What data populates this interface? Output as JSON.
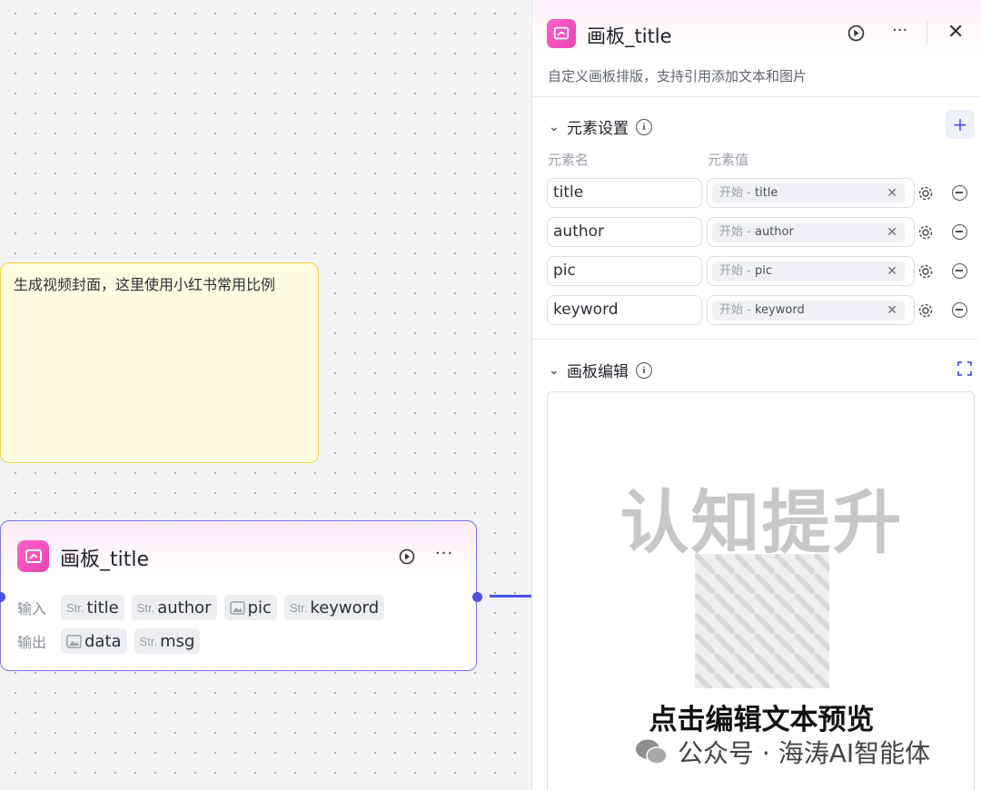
{
  "canvas": {
    "note": {
      "text": "生成视频封面，这里使用小红书常用比例"
    },
    "node": {
      "title": "画板_title",
      "input_label": "输入",
      "output_label": "输出",
      "inputs": [
        {
          "type": "Str.",
          "name": "title",
          "icon": ""
        },
        {
          "type": "Str.",
          "name": "author",
          "icon": ""
        },
        {
          "type": "",
          "name": "pic",
          "icon": "image-icon"
        },
        {
          "type": "Str.",
          "name": "keyword",
          "icon": ""
        }
      ],
      "outputs": [
        {
          "type": "",
          "name": "data",
          "icon": "image-icon"
        },
        {
          "type": "Str.",
          "name": "msg",
          "icon": ""
        }
      ]
    }
  },
  "panel": {
    "title": "画板_title",
    "description": "自定义画板排版，支持引用添加文本和图片",
    "elements_section": {
      "title": "元素设置",
      "col_name": "元素名",
      "col_value": "元素值",
      "rows": [
        {
          "name": "title",
          "source": "开始",
          "var": "title"
        },
        {
          "name": "author",
          "source": "开始",
          "var": "author"
        },
        {
          "name": "pic",
          "source": "开始",
          "var": "pic"
        },
        {
          "name": "keyword",
          "source": "开始",
          "var": "keyword"
        }
      ]
    },
    "board_section": {
      "title": "画板编辑",
      "preview_big_text": "认知提升",
      "preview_caption": "点击编辑文本预览"
    }
  },
  "watermark": {
    "text": "公众号 · 海涛AI智能体"
  },
  "colors": {
    "accent": "#4d53e8",
    "node_icon": "#e941b4",
    "note_bg": "#fffbe0",
    "note_border": "#f3cd45"
  }
}
